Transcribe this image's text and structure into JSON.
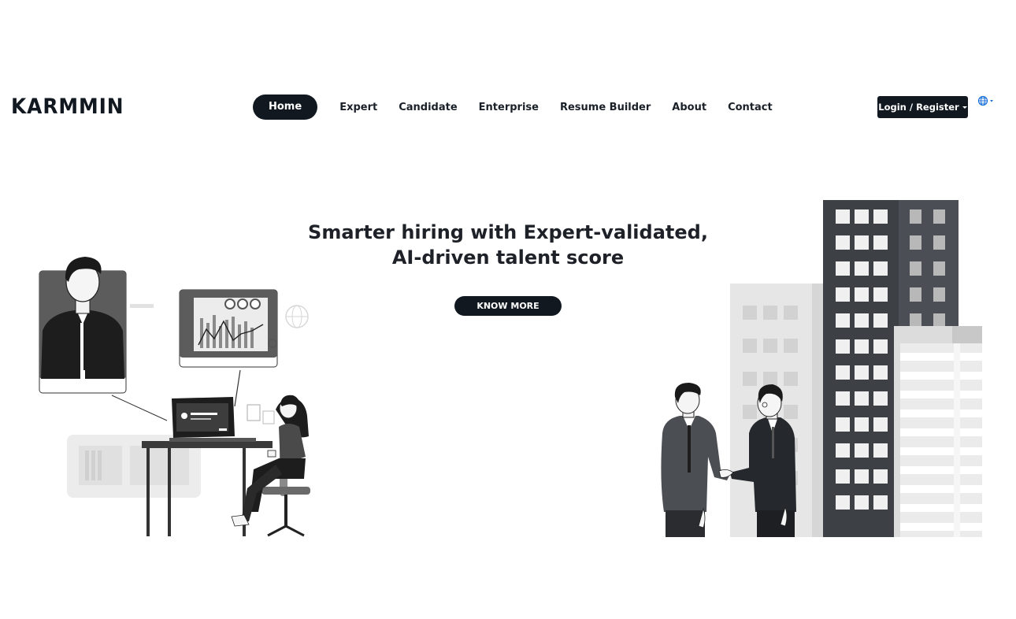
{
  "brand": {
    "logo_text": "KARMMIN"
  },
  "nav": {
    "items": [
      {
        "label": "Home",
        "active": true
      },
      {
        "label": "Expert",
        "active": false
      },
      {
        "label": "Candidate",
        "active": false
      },
      {
        "label": "Enterprise",
        "active": false
      },
      {
        "label": "Resume Builder",
        "active": false
      },
      {
        "label": "About",
        "active": false
      },
      {
        "label": "Contact",
        "active": false
      }
    ]
  },
  "header": {
    "login_label": "Login / Register",
    "language_icon": "globe-icon"
  },
  "hero": {
    "title_line1": "Smarter hiring with Expert-validated,",
    "title_line2": "AI-driven talent score",
    "cta_label": "KNOW MORE"
  },
  "colors": {
    "primary": "#111820",
    "accent": "#1a6fd6",
    "background": "#ffffff"
  }
}
